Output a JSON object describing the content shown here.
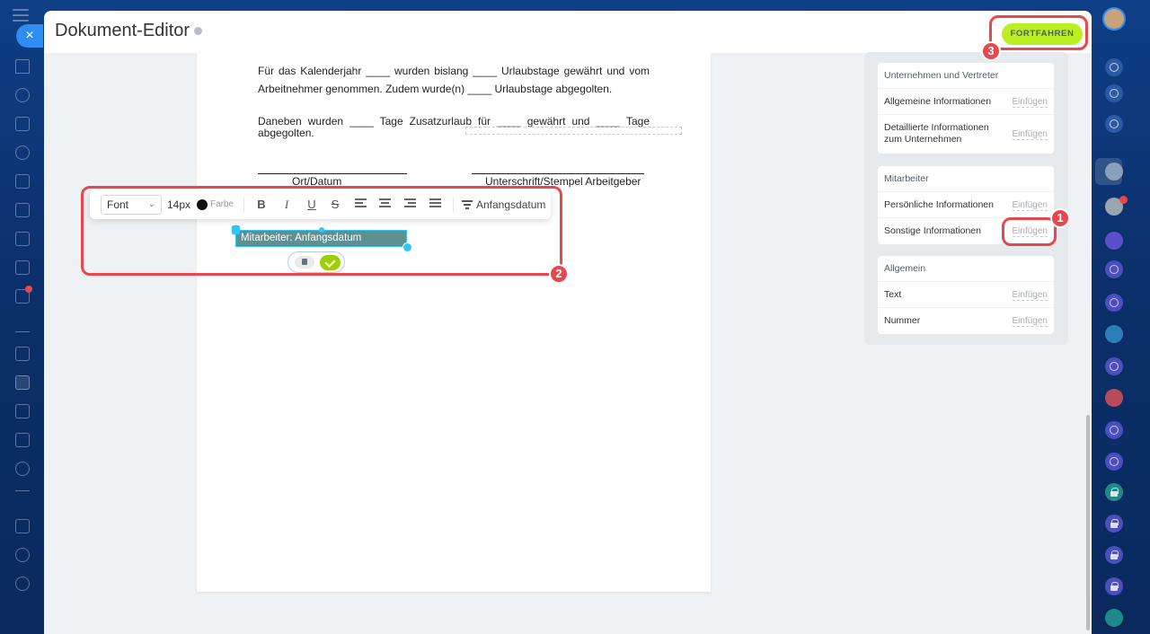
{
  "header": {
    "title": "Dokument-Editor",
    "continue_label": "FORTFAHREN"
  },
  "document": {
    "paragraph1": "Für das Kalenderjahr ____ wurden bislang ____ Urlaubstage gewährt und vom Arbeitnehmer genommen. Zudem wurde(n) ____ Urlaubstage abgegolten.",
    "paragraph2": "Daneben wurden ____ Tage Zusatzurlaub für ____ gewährt und ____ Tage abgegolten.",
    "sig_left": "Ort/Datum",
    "sig_right": "Unterschrift/Stempel Arbeitgeber"
  },
  "toolbar": {
    "font": "Font",
    "size": "14px",
    "color_label": "Farbe",
    "bold": "B",
    "italic": "I",
    "underline": "U",
    "strike": "S",
    "field_name": "Anfangsdatum"
  },
  "field": {
    "label": "Mitarbeiter: Anfangsdatum"
  },
  "sidebar": {
    "groups": [
      {
        "title": "Unternehmen und Vertreter",
        "rows": [
          {
            "label": "Allgemeine Informationen",
            "action": "Einfügen"
          },
          {
            "label": "Detaillierte Informationen zum Unternehmen",
            "action": "Einfügen"
          }
        ]
      },
      {
        "title": "Mitarbeiter",
        "rows": [
          {
            "label": "Persönliche Informationen",
            "action": "Einfügen"
          },
          {
            "label": "Sonstige Informationen",
            "action": "Einfügen"
          }
        ]
      },
      {
        "title": "Allgemein",
        "rows": [
          {
            "label": "Text",
            "action": "Einfügen"
          },
          {
            "label": "Nummer",
            "action": "Einfügen"
          }
        ]
      }
    ]
  },
  "annotations": {
    "one": "1",
    "two": "2",
    "three": "3"
  },
  "right_rail": {
    "notification_count": "1"
  },
  "colors": {
    "accent": "#bbed21",
    "annotation": "#e8474e",
    "field_border": "#2fc6f6"
  }
}
